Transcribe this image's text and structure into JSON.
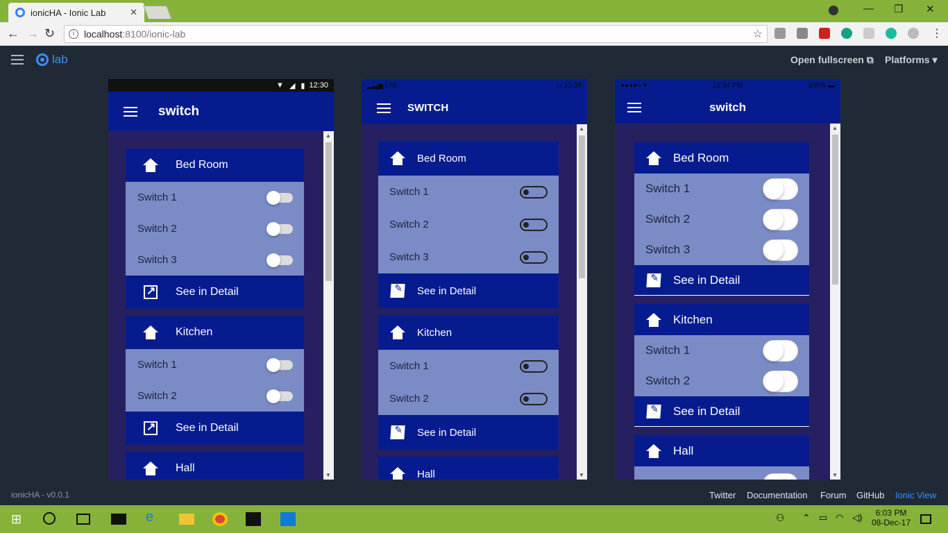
{
  "browser": {
    "tab_title": "ionicHA - Ionic Lab",
    "tab_close": "✕",
    "url_host": "localhost",
    "url_path": ":8100/ionic-lab",
    "minimize": "—",
    "restore": "❐",
    "close": "✕"
  },
  "lab": {
    "logo_text": "lab",
    "open_fullscreen": "Open fullscreen",
    "platforms": "Platforms"
  },
  "devices": {
    "android": {
      "status_time": "12:30",
      "title": "switch",
      "rooms": [
        {
          "name": "Bed Room",
          "switches": [
            "Switch 1",
            "Switch 2",
            "Switch 3"
          ],
          "detail": "See in Detail"
        },
        {
          "name": "Kitchen",
          "switches": [
            "Switch 1",
            "Switch 2"
          ],
          "detail": "See in Detail"
        },
        {
          "name": "Hall"
        }
      ]
    },
    "windows": {
      "status_left": "LTE",
      "status_time": "12:34",
      "title": "SWITCH",
      "rooms": [
        {
          "name": "Bed Room",
          "switches": [
            "Switch 1",
            "Switch 2",
            "Switch 3"
          ],
          "detail": "See in Detail"
        },
        {
          "name": "Kitchen",
          "switches": [
            "Switch 1",
            "Switch 2"
          ],
          "detail": "See in Detail"
        },
        {
          "name": "Hall"
        }
      ]
    },
    "ios": {
      "status_time": "12:34 PM",
      "status_battery": "100%",
      "title": "switch",
      "rooms": [
        {
          "name": "Bed Room",
          "switches": [
            "Switch 1",
            "Switch 2",
            "Switch 3"
          ],
          "detail": "See in Detail"
        },
        {
          "name": "Kitchen",
          "switches": [
            "Switch 1",
            "Switch 2"
          ],
          "detail": "See in Detail"
        },
        {
          "name": "Hall"
        }
      ]
    }
  },
  "footer": {
    "version": "ionicHA - v0.0.1",
    "links": [
      "Twitter",
      "Documentation",
      "Forum",
      "GitHub",
      "Ionic View"
    ]
  },
  "taskbar": {
    "time": "6:03 PM",
    "date": "08-Dec-17"
  },
  "colors": {
    "primary": "#061c8e",
    "card_body": "#7b8bc6",
    "content_bg": "#272060",
    "ionic_blue": "#3d8ff7"
  }
}
